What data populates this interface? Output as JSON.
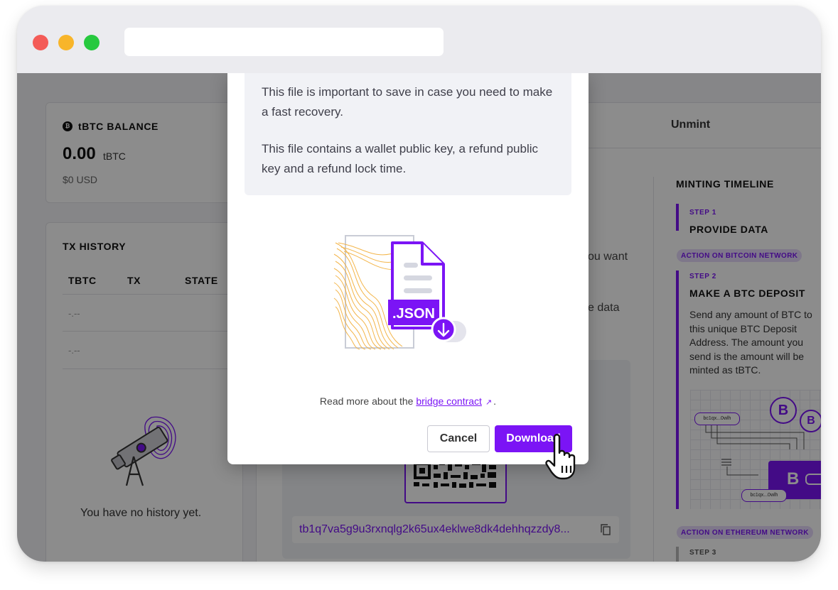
{
  "balance": {
    "label": "tBTC BALANCE",
    "amount": "0.00",
    "unit": "tBTC",
    "usd": "$0 USD"
  },
  "tx_history": {
    "title": "TX HISTORY",
    "columns": [
      "TBTC",
      "TX",
      "STATE"
    ],
    "rows": [
      [
        "-.--"
      ],
      [
        "-.--"
      ]
    ],
    "empty_text": "You have no history yet."
  },
  "tabs": {
    "unmint": "Unmint"
  },
  "main": {
    "partial_1": "ou want",
    "partial_2": "e data",
    "deposit_address": "tb1q7va5g9u3rxnqlg2k65ux4eklwe8dk4dehhqzzdy8..."
  },
  "timeline": {
    "title": "MINTING TIMELINE",
    "step1_num": "STEP 1",
    "step1_title": "PROVIDE DATA",
    "chip_bitcoin": "ACTION ON BITCOIN NETWORK",
    "step2_num": "STEP 2",
    "step2_title": "MAKE A BTC DEPOSIT",
    "step2_desc": "Send any amount of BTC to this unique BTC Deposit Address. The amount you send is the amount will be minted as tBTC.",
    "illustration": {
      "addr_1": "bc1qx...0wlh",
      "addr_2": "bc1qx...0wlh",
      "btc_symbol": "B"
    },
    "chip_ethereum": "ACTION ON ETHEREUM NETWORK",
    "step3_num": "STEP 3"
  },
  "modal": {
    "para_1": "This file is important to save in case you need to make a fast recovery.",
    "para_2": "This file contains a wallet public key, a refund public key and a refund lock time.",
    "file_badge": ".JSON",
    "read_more_prefix": "Read more about the ",
    "read_more_link": "bridge contract",
    "read_more_suffix": ".",
    "cancel_label": "Cancel",
    "download_label": "Download"
  },
  "colors": {
    "accent": "#7b14f5",
    "overlay": "rgba(0,0,0,0.45)",
    "traffic_red": "#f45b57",
    "traffic_yellow": "#f8b52a",
    "traffic_green": "#27c93f"
  },
  "icons": [
    "tbtc-coin-icon",
    "copy-icon",
    "telescope-icon",
    "json-file-icon",
    "download-arrow-icon",
    "external-link-icon",
    "hand-cursor-icon",
    "bitcoin-coin-icon",
    "wallet-icon"
  ]
}
